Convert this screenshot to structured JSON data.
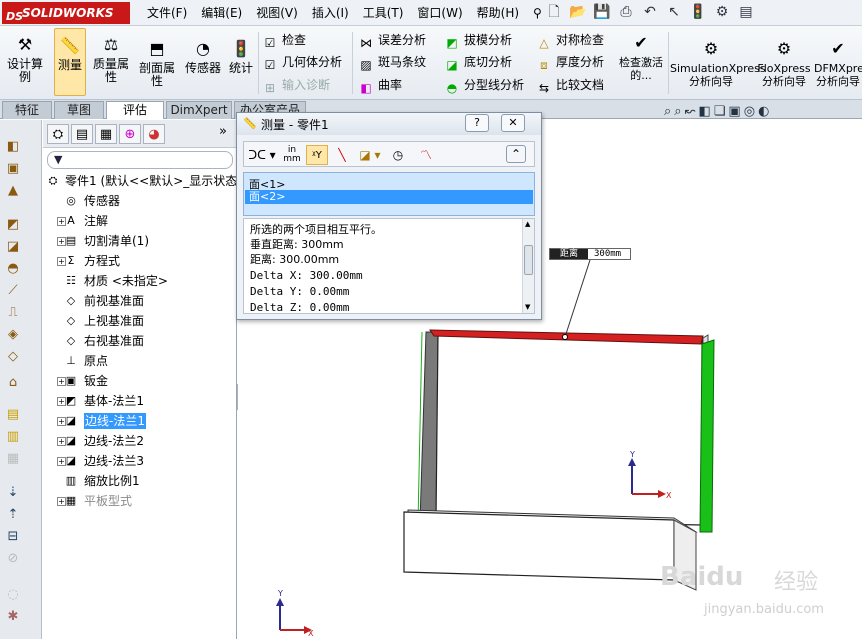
{
  "app": {
    "logo": "SOLIDWORKS",
    "logo_prefix": "DS"
  },
  "menu": [
    "文件(F)",
    "编辑(E)",
    "视图(V)",
    "插入(I)",
    "工具(T)",
    "窗口(W)",
    "帮助(H)"
  ],
  "quick_icons": [
    "new-icon",
    "open-icon",
    "save-icon",
    "print-icon",
    "undo-icon",
    "select-icon",
    "rebuild-icon",
    "options-icon",
    "file-properties-icon"
  ],
  "ribbon": {
    "design_calc": "设计算例",
    "measure": "测量",
    "mass_props": "质量属性",
    "section_props": "剖面属性",
    "sensor": "传感器",
    "statistics": "统计",
    "check": "检查",
    "geometry_analysis": "几何体分析",
    "import_diagnostics": "输入诊断",
    "deviation_analysis": "误差分析",
    "zebra": "斑马条纹",
    "curvature": "曲率",
    "draft_analysis": "拔模分析",
    "undercut_analysis": "底切分析",
    "parting_line": "分型线分析",
    "symmetry_check": "对称检查",
    "thickness_analysis": "厚度分析",
    "compare_docs": "比较文档",
    "check_active": "检查激活的...",
    "simxpress": "SimulationXpress 分析向导",
    "floxpress": "FloXpress 分析向导",
    "dfmxpress": "DFMXpress 分析向导"
  },
  "tabs": [
    "特征",
    "草图",
    "评估",
    "DimXpert",
    "办公室产品"
  ],
  "active_tab": "评估",
  "tree": [
    {
      "label": "零件1 (默认<<默认>_显示状态",
      "icon": "part-icon",
      "expand": false,
      "indent": 0
    },
    {
      "label": "传感器",
      "icon": "sensor-icon",
      "expand": false,
      "indent": 1
    },
    {
      "label": "注解",
      "icon": "annotation-icon",
      "expand": true,
      "indent": 1
    },
    {
      "label": "切割清单(1)",
      "icon": "cut-list-icon",
      "expand": true,
      "indent": 1
    },
    {
      "label": "方程式",
      "icon": "equation-icon",
      "expand": true,
      "indent": 1
    },
    {
      "label": "材质 <未指定>",
      "icon": "material-icon",
      "expand": false,
      "indent": 1
    },
    {
      "label": "前视基准面",
      "icon": "plane-icon",
      "expand": false,
      "indent": 1
    },
    {
      "label": "上视基准面",
      "icon": "plane-icon",
      "expand": false,
      "indent": 1
    },
    {
      "label": "右视基准面",
      "icon": "plane-icon",
      "expand": false,
      "indent": 1
    },
    {
      "label": "原点",
      "icon": "origin-icon",
      "expand": false,
      "indent": 1
    },
    {
      "label": "钣金",
      "icon": "sheet-metal-icon",
      "expand": true,
      "indent": 1
    },
    {
      "label": "基体-法兰1",
      "icon": "base-flange-icon",
      "expand": true,
      "indent": 1
    },
    {
      "label": "边线-法兰1",
      "icon": "edge-flange-icon",
      "expand": true,
      "indent": 1,
      "selected": true
    },
    {
      "label": "边线-法兰2",
      "icon": "edge-flange-icon",
      "expand": true,
      "indent": 1
    },
    {
      "label": "边线-法兰3",
      "icon": "edge-flange-icon",
      "expand": true,
      "indent": 1
    },
    {
      "label": "缩放比例1",
      "icon": "scale-icon",
      "expand": false,
      "indent": 1
    },
    {
      "label": "平板型式",
      "icon": "flat-pattern-icon",
      "expand": true,
      "indent": 1,
      "gray": true
    }
  ],
  "measure": {
    "title": "测量 - 零件1",
    "help": "?",
    "close": "✕",
    "unit_in": "in",
    "unit_mm": "mm",
    "selections": [
      "面<1>",
      "面<2>"
    ],
    "results": [
      "所选的两个项目相互平行。",
      "垂直距离: 300mm",
      "距离: 300.00mm",
      "Delta X: 300.00mm",
      "Delta Y: 0.00mm",
      "Delta Z: 0.00mm"
    ]
  },
  "callout": {
    "label": "距离",
    "value": "300mm"
  },
  "watermark": {
    "brand": "Baidu",
    "cn": "经验",
    "url": "jingyan.baidu.com"
  },
  "colors": {
    "accent_red": "#e02020",
    "accent_green": "#18c018",
    "selection": "#3399ff"
  }
}
